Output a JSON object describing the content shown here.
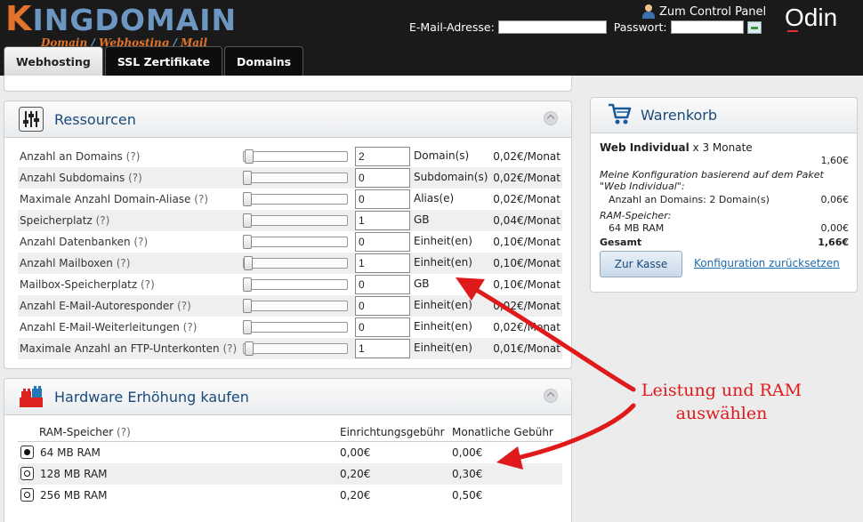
{
  "header": {
    "logo_main": "INGDOMAIN",
    "logo_k": "K",
    "logo_sub": [
      "Domain",
      "Webhosting",
      "Mail"
    ],
    "logo_sep": "/",
    "control_panel_link": "Zum Control Panel",
    "brand_right": "Odin",
    "email_label": "E-Mail-Adresse:",
    "password_label": "Passwort:",
    "email_value": "",
    "password_value": ""
  },
  "tabs": [
    {
      "label": "Webhosting",
      "active": true
    },
    {
      "label": "SSL Zertifikate",
      "active": false
    },
    {
      "label": "Domains",
      "active": false
    }
  ],
  "resources": {
    "title": "Ressourcen",
    "rows": [
      {
        "label": "Anzahl an Domains",
        "help": "(?)",
        "value": "2",
        "unit": "Domain(s)",
        "price": "0,02€/Monat",
        "slider_fraction": 0.02
      },
      {
        "label": "Anzahl Subdomains",
        "help": "(?)",
        "value": "0",
        "unit": "Subdomain(s)",
        "price": "0,02€/Monat",
        "slider_fraction": 0.0
      },
      {
        "label": "Maximale Anzahl Domain-Aliase",
        "help": "(?)",
        "value": "0",
        "unit": "Alias(e)",
        "price": "0,02€/Monat",
        "slider_fraction": 0.0
      },
      {
        "label": "Speicherplatz",
        "help": "(?)",
        "value": "1",
        "unit": "GB",
        "price": "0,04€/Monat",
        "slider_fraction": 0.0
      },
      {
        "label": "Anzahl Datenbanken",
        "help": "(?)",
        "value": "0",
        "unit": "Einheit(en)",
        "price": "0,10€/Monat",
        "slider_fraction": 0.0
      },
      {
        "label": "Anzahl Mailboxen",
        "help": "(?)",
        "value": "1",
        "unit": "Einheit(en)",
        "price": "0,10€/Monat",
        "slider_fraction": 0.01
      },
      {
        "label": "Mailbox-Speicherplatz",
        "help": "(?)",
        "value": "0",
        "unit": "GB",
        "price": "0,10€/Monat",
        "slider_fraction": 0.0
      },
      {
        "label": "Anzahl E-Mail-Autoresponder",
        "help": "(?)",
        "value": "0",
        "unit": "Einheit(en)",
        "price": "0,02€/Monat",
        "slider_fraction": 0.0
      },
      {
        "label": "Anzahl E-Mail-Weiterleitungen",
        "help": "(?)",
        "value": "0",
        "unit": "Einheit(en)",
        "price": "0,02€/Monat",
        "slider_fraction": 0.0
      },
      {
        "label": "Maximale Anzahl an FTP-Unterkonten",
        "help": "(?)",
        "value": "1",
        "unit": "Einheit(en)",
        "price": "0,01€/Monat",
        "slider_fraction": 0.02
      }
    ]
  },
  "hardware": {
    "title": "Hardware Erhöhung kaufen",
    "col_ram": "RAM-Speicher",
    "col_help": "(?)",
    "col_setup": "Einrichtungsgebühr",
    "col_monthly": "Monatliche Gebühr",
    "rows": [
      {
        "label": "64 MB RAM",
        "setup": "0,00€",
        "monthly": "0,00€",
        "selected": true
      },
      {
        "label": "128 MB RAM",
        "setup": "0,20€",
        "monthly": "0,30€",
        "selected": false
      },
      {
        "label": "256 MB RAM",
        "setup": "0,20€",
        "monthly": "0,50€",
        "selected": false
      }
    ]
  },
  "cart": {
    "title": "Warenkorb",
    "product": "Web Individual",
    "duration": "x 3 Monate",
    "product_price": "1,60€",
    "config_note_1": "Meine Konfiguration basierend auf dem Paket",
    "config_note_2": "\"Web Individual\":",
    "domains_line": "Anzahl an Domains: 2 Domain(s)",
    "domains_price": "0,06€",
    "ram_label": "RAM-Speicher:",
    "ram_value": "64 MB RAM",
    "ram_price": "0,00€",
    "total_label": "Gesamt",
    "total_price": "1,66€",
    "checkout_button": "Zur Kasse",
    "reset_link": "Konfiguration zurücksetzen"
  },
  "annotation": {
    "line1": "Leistung und RAM",
    "line2": "auswählen",
    "color": "#e0191a"
  },
  "colors": {
    "header_bg": "#1a1a1a",
    "title_blue": "#1b4a78",
    "logo_orange": "#e2732b",
    "logo_blue": "#6d97c3"
  }
}
